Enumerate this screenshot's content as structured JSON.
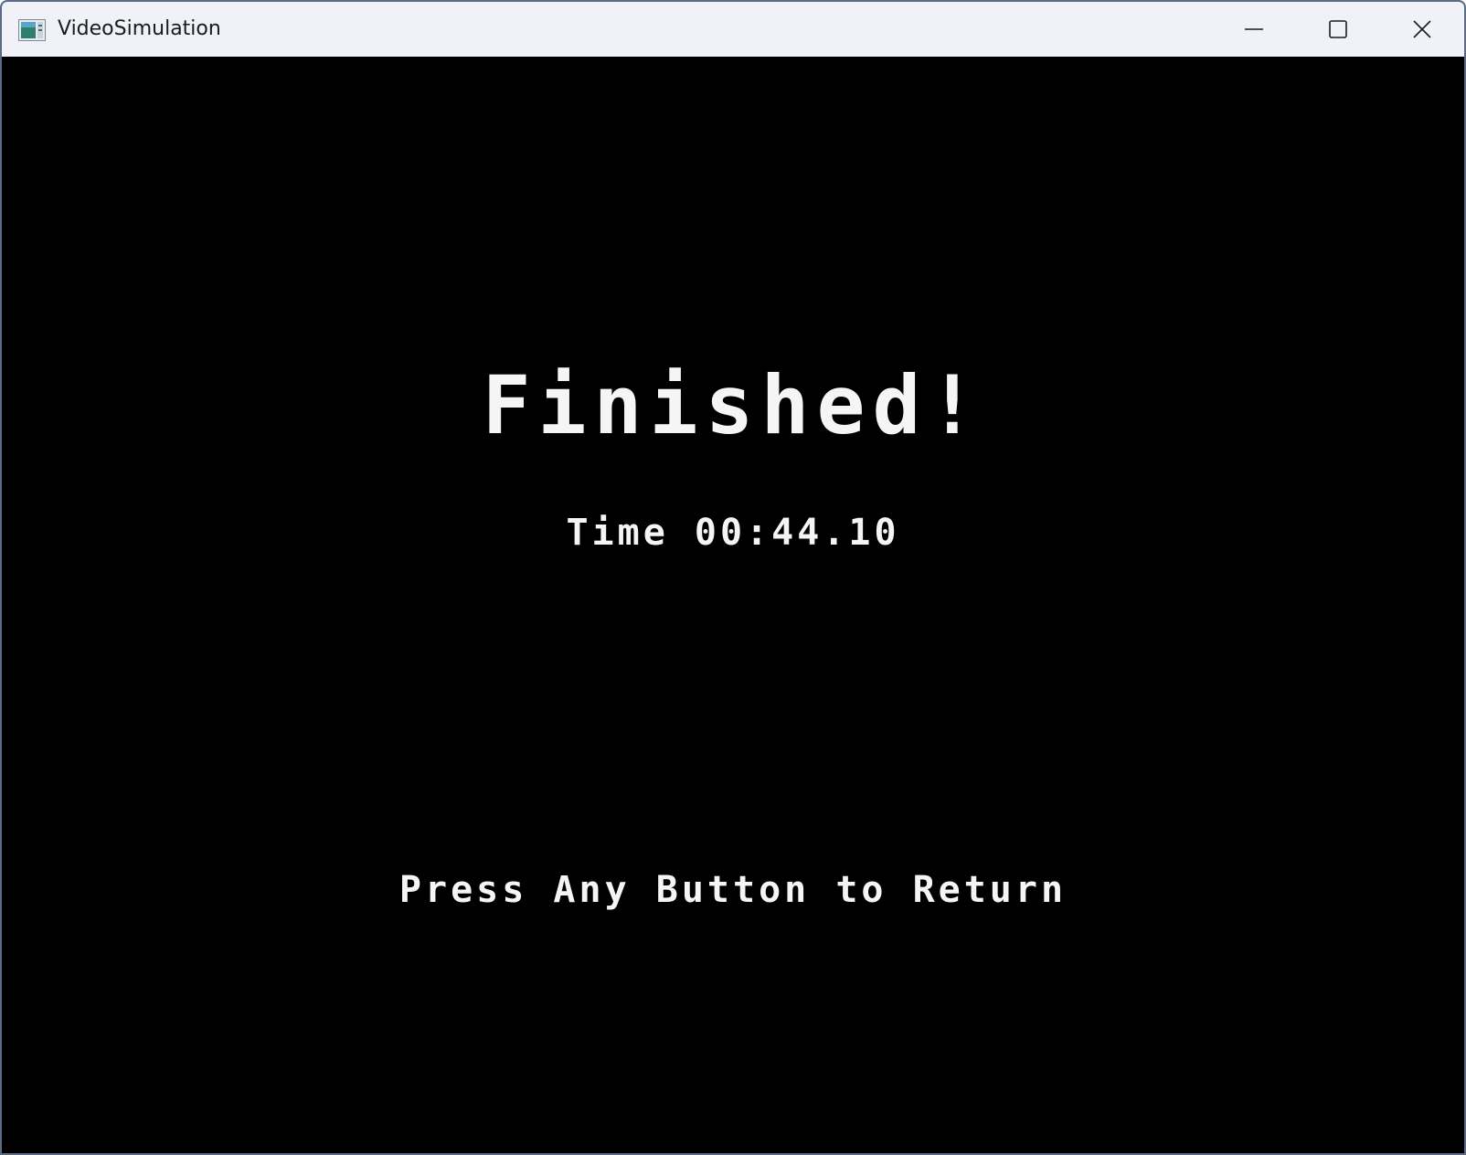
{
  "window": {
    "title": "VideoSimulation",
    "app_icon": "application-window-icon",
    "controls": {
      "minimize_icon": "minimize-icon",
      "maximize_icon": "maximize-icon",
      "close_icon": "close-icon"
    }
  },
  "game": {
    "headline": "Finished!",
    "time_label": "Time",
    "time_value": "00:44.10",
    "prompt": "Press Any Button to Return"
  },
  "colors": {
    "background": "#000000",
    "text": "#f5f5f5",
    "titlebar": "#f0f2f8"
  }
}
